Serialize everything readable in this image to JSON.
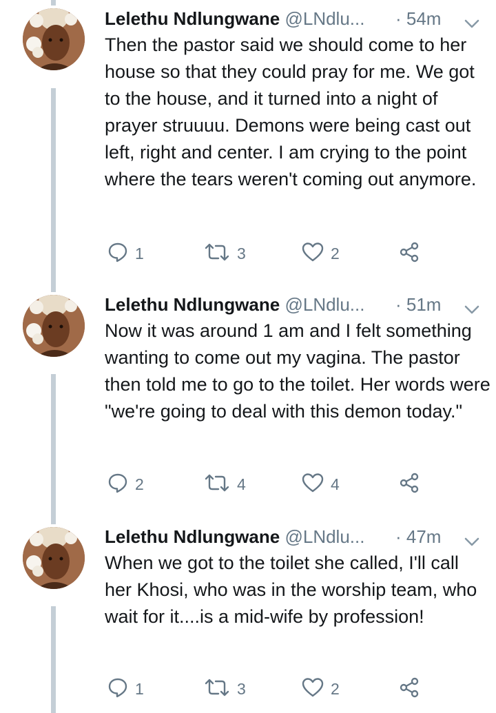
{
  "tweets": [
    {
      "name": "Lelethu Ndlungwane",
      "handle": "@LNdlu...",
      "time": "· 54m",
      "text": "Then the pastor  said we should come to her house so that they could pray for me. We got to the house, and it turned into a night of prayer struuuu. Demons were being cast out left, right and center. I am crying to the point where the tears weren't coming out anymore.",
      "replies": "1",
      "retweets": "3",
      "likes": "2"
    },
    {
      "name": "Lelethu Ndlungwane",
      "handle": "@LNdlu...",
      "time": "· 51m",
      "text": "Now it was around 1 am and I felt something wanting to come out my vagina. The pastor then told me to go to the toilet. Her words were \"we're going to deal with this demon today.\"",
      "replies": "2",
      "retweets": "4",
      "likes": "4"
    },
    {
      "name": "Lelethu Ndlungwane",
      "handle": "@LNdlu...",
      "time": "· 47m",
      "text": "When we got to the toilet she called, I'll call her Khosi, who was in the worship team, who wait for it....is a mid-wife by profession!",
      "replies": "1",
      "retweets": "3",
      "likes": "2"
    }
  ],
  "icons": {
    "reply": "reply-icon",
    "retweet": "retweet-icon",
    "like": "heart-icon",
    "share": "share-icon",
    "menu": "chevron-down-icon"
  },
  "colors": {
    "text": "#14171a",
    "secondary": "#657786",
    "thread_line": "#c4ced6"
  }
}
